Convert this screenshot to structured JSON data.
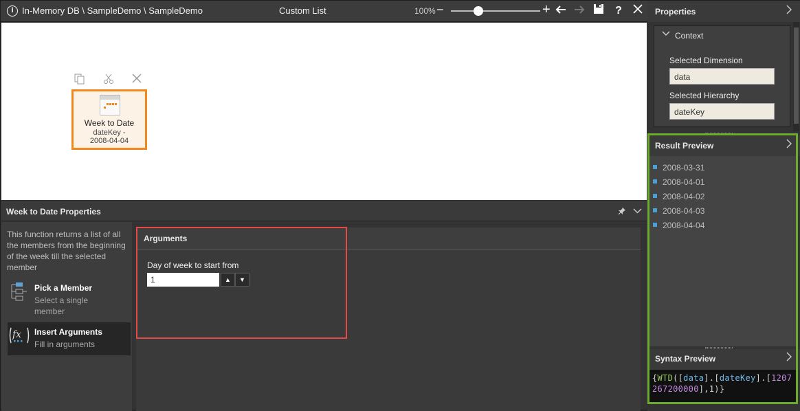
{
  "titlebar": {
    "path": "In-Memory DB \\ SampleDemo \\ SampleDemo",
    "title": "Custom List",
    "zoom": "100%",
    "zoom_level_fraction": 0.3,
    "icons": [
      "info-icon",
      "zoom-out-icon",
      "zoom-slider",
      "zoom-in-icon",
      "undo-icon",
      "redo-icon",
      "save-icon",
      "help-icon",
      "close-icon"
    ]
  },
  "node": {
    "title": "Week to Date",
    "subtitle_line1": "dateKey -",
    "subtitle_line2": "2008-04-04",
    "tool_icons": [
      "copy-icon",
      "cut-icon",
      "delete-icon"
    ]
  },
  "properties_panel": {
    "title": "Week to Date Properties",
    "description": "This function returns a list of all the members from the beginning of the week till the selected member",
    "tools": [
      {
        "title": "Pick a Member",
        "subtitle": "Select a single member",
        "icon": "hierarchy-icon"
      },
      {
        "title": "Insert Arguments",
        "subtitle": "Fill in arguments",
        "icon": "fx-icon"
      }
    ]
  },
  "arguments": {
    "title": "Arguments",
    "label": "Day of week to start from",
    "value": "1"
  },
  "right": {
    "properties_title": "Properties",
    "context_title": "Context",
    "dimension_label": "Selected Dimension",
    "dimension_value": "data",
    "hierarchy_label": "Selected Hierarchy",
    "hierarchy_value": "dateKey",
    "result_title": "Result Preview",
    "results": [
      "2008-03-31",
      "2008-04-01",
      "2008-04-02",
      "2008-04-03",
      "2008-04-04"
    ],
    "syntax_title": "Syntax Preview",
    "syntax": {
      "p1": "{",
      "fn": "WTD",
      "p2": "([",
      "k1": "data",
      "p3": "].[",
      "k2": "dateKey",
      "p4": "].[",
      "num": "1207267200000",
      "p5": "],1)}"
    }
  },
  "colors": {
    "node_border": "#f0881c",
    "arguments_highlight": "#e44b48",
    "preview_highlight": "#6cab2e",
    "result_bullet": "#4a9fd4"
  }
}
